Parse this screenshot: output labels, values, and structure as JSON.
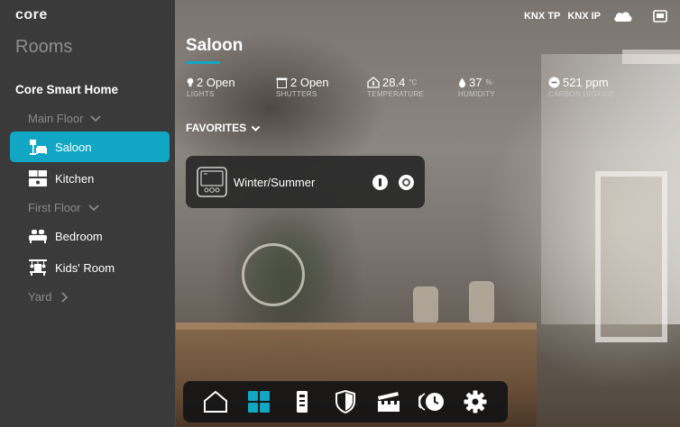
{
  "brand": {
    "logo_text": "core",
    "accent": "#11a7c4"
  },
  "sidebar": {
    "title": "Rooms",
    "home_name": "Core Smart Home",
    "floors": [
      {
        "label": "Main Floor",
        "expanded": true
      },
      {
        "label": "First Floor",
        "expanded": true
      },
      {
        "label": "Yard",
        "expanded": false
      }
    ],
    "rooms": [
      {
        "label": "Saloon",
        "icon": "sofa-lamp-icon",
        "active": true
      },
      {
        "label": "Kitchen",
        "icon": "kitchen-icon",
        "active": false
      },
      {
        "label": "Bedroom",
        "icon": "bed-icon",
        "active": false
      },
      {
        "label": "Kids' Room",
        "icon": "kids-room-icon",
        "active": false
      }
    ]
  },
  "header": {
    "title": "Saloon",
    "status": {
      "knx_tp": "KNX TP",
      "knx_ip": "KNX IP"
    }
  },
  "stats": {
    "lights": {
      "value": "2 Open",
      "label": "LIGHTS"
    },
    "shutters": {
      "value": "2 Open",
      "label": "SHUTTERS"
    },
    "temperature": {
      "value": "28.4",
      "unit": "°C",
      "label": "TEMPERATURE"
    },
    "humidity": {
      "value": "37",
      "unit": "%",
      "label": "HUMIDITY"
    },
    "co2": {
      "value": "521 ppm",
      "label": "CARBON DIOXIDE"
    }
  },
  "favorites": {
    "label": "FAVORITES",
    "items": [
      {
        "name": "Winter/Summer",
        "icon": "thermostat-panel-icon"
      }
    ]
  },
  "bottom_nav": [
    {
      "name": "home",
      "icon": "home-icon",
      "active": false
    },
    {
      "name": "rooms",
      "icon": "grid-icon",
      "active": true
    },
    {
      "name": "devices",
      "icon": "device-panel-icon",
      "active": false
    },
    {
      "name": "security",
      "icon": "shield-icon",
      "active": false
    },
    {
      "name": "scenes",
      "icon": "clapperboard-icon",
      "active": false
    },
    {
      "name": "schedules",
      "icon": "clock-icon",
      "active": false
    },
    {
      "name": "settings",
      "icon": "gear-icon",
      "active": false
    }
  ]
}
